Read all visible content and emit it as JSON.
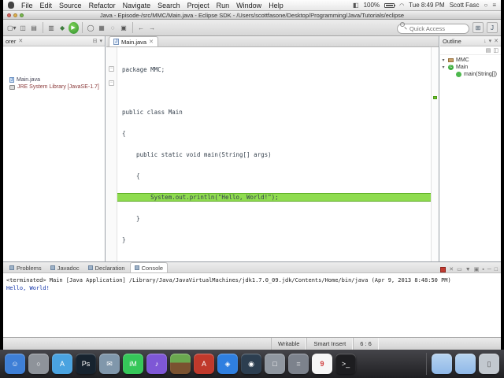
{
  "menubar": {
    "items": [
      "File",
      "Edit",
      "Source",
      "Refactor",
      "Navigate",
      "Search",
      "Project",
      "Run",
      "Window",
      "Help"
    ],
    "status": {
      "battery_pct": "100%",
      "clock": "Tue 8:49 PM",
      "user": "Scott Fasc"
    }
  },
  "titlebar": {
    "title": "Java - Episode-/src/MMC/Main.java - Eclipse SDK - /Users/scottfasone/Desktop/Programming/Java/Tutorials/eclipse"
  },
  "toolbar": {
    "quick_access_placeholder": "Quick Access",
    "buttons": [
      {
        "name": "new",
        "glyph": "▢▾"
      },
      {
        "name": "save",
        "glyph": "◫"
      },
      {
        "name": "print",
        "glyph": "▤"
      },
      {
        "name": "export",
        "glyph": "▥"
      },
      {
        "name": "debug",
        "glyph": "◆"
      },
      {
        "name": "run",
        "glyph": "▶"
      },
      {
        "name": "new-class",
        "glyph": "◯"
      },
      {
        "name": "new-package",
        "glyph": "▦"
      },
      {
        "name": "search",
        "glyph": "◌"
      },
      {
        "name": "coverage",
        "glyph": "▣"
      },
      {
        "name": "back",
        "glyph": "←"
      },
      {
        "name": "forward",
        "glyph": "→"
      }
    ],
    "perspective_java": "J",
    "perspective_open": "⊞"
  },
  "explorer": {
    "tab_label": "orer",
    "close_glyph": "✕",
    "menu_glyph": "▾",
    "collapse_glyph": "⊟",
    "items": [
      {
        "label": "Main.java"
      },
      {
        "label": "JRE System Library [JavaSE-1.7]"
      }
    ]
  },
  "editor": {
    "tab": "Main.java",
    "tab_icon": "J",
    "close_glyph": "✕",
    "lines": [
      "package MMC;",
      "",
      "public class Main",
      "{",
      "    public static void main(String[] args)",
      "    {",
      "        System.out.println(\"Hello, World!\");",
      "    }",
      "}"
    ]
  },
  "outline": {
    "title": "Outline",
    "head_icons": [
      "↓",
      "▾",
      "✕"
    ],
    "row_icons": [
      "▤",
      "◫"
    ],
    "items": [
      {
        "label": "MMC",
        "twisty": "▾"
      },
      {
        "label": "Main",
        "twisty": "▾"
      },
      {
        "label": "main(String[])",
        "twisty": ""
      }
    ]
  },
  "console": {
    "tabs": [
      "Problems",
      "Javadoc",
      "Declaration",
      "Console"
    ],
    "active_tab": "Console",
    "action_icons": [
      "✕",
      "▭",
      "▼",
      "▣",
      "▪",
      "─",
      "□"
    ],
    "header": "<terminated> Main [Java Application] /Library/Java/JavaVirtualMachines/jdk1.7.0_09.jdk/Contents/Home/bin/java (Apr 9, 2013 8:48:50 PM)",
    "output": "Hello, World!"
  },
  "statusbar": {
    "writable": "Writable",
    "insert_mode": "Smart Insert",
    "position": "6 : 6"
  },
  "dock": {
    "items": [
      {
        "name": "finder",
        "glyph": "☺",
        "color": "#3e7fd6"
      },
      {
        "name": "launchpad",
        "glyph": "○",
        "color": "#8e939a"
      },
      {
        "name": "app-store",
        "glyph": "A",
        "color": "#4aa3e0"
      },
      {
        "name": "photoshop",
        "glyph": "Ps",
        "color": "#17232f"
      },
      {
        "name": "mail",
        "glyph": "✉",
        "color": "#8097ab"
      },
      {
        "name": "messages",
        "glyph": "iM",
        "color": "#35c759"
      },
      {
        "name": "itunes",
        "glyph": "♪",
        "color": "#7e57d6"
      },
      {
        "name": "minecraft",
        "glyph": "",
        "color": ""
      },
      {
        "name": "red-app",
        "glyph": "A",
        "color": "#c0392b"
      },
      {
        "name": "safari",
        "glyph": "◈",
        "color": "#2f7fe0"
      },
      {
        "name": "steam",
        "glyph": "◉",
        "color": "#2c3e50"
      },
      {
        "name": "utility",
        "glyph": "□",
        "color": "#9097a0"
      },
      {
        "name": "calculator",
        "glyph": "=",
        "color": "#7c828c"
      },
      {
        "name": "calendar",
        "glyph": "9",
        "color": "#f6f6f6"
      },
      {
        "name": "terminal",
        "glyph": ">_",
        "color": "#1d1d20"
      },
      {
        "name": "downloads-folder",
        "glyph": "",
        "color": "linear-gradient(#b8d4f0,#8fb8e8)"
      },
      {
        "name": "documents-folder",
        "glyph": "",
        "color": "linear-gradient(#b8d4f0,#8fb8e8)"
      },
      {
        "name": "trash",
        "glyph": "▯",
        "color": "#c2c8cf"
      }
    ]
  }
}
